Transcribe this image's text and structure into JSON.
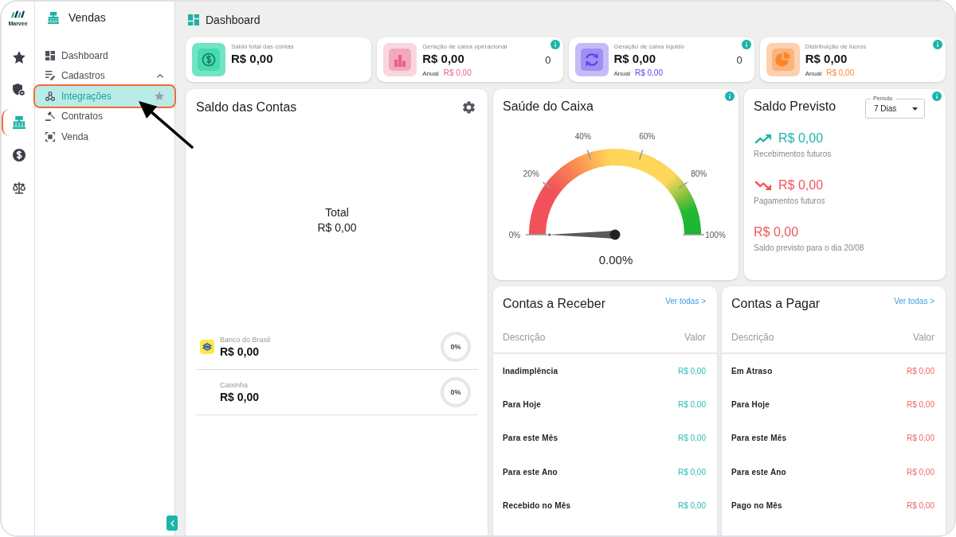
{
  "rail": {
    "logo_text": "Marvee",
    "items": [
      {
        "kind": "star",
        "selected": false
      },
      {
        "kind": "shield",
        "selected": false
      },
      {
        "kind": "register",
        "selected": true
      },
      {
        "kind": "dollar",
        "selected": false
      },
      {
        "kind": "scales",
        "selected": false
      }
    ]
  },
  "sidebar": {
    "title": "Vendas",
    "items": [
      {
        "label": "Dashboard",
        "kind": "dashboard",
        "selected": false
      },
      {
        "label": "Cadastros",
        "kind": "list",
        "expanded": true,
        "children": [
          {
            "label": "Integrações",
            "kind": "integration",
            "selected": true,
            "outlined": true
          },
          {
            "label": "Contratos",
            "kind": "gavel",
            "selected": false,
            "outlined": false
          },
          {
            "label": "Venda",
            "kind": "frame",
            "selected": false,
            "outlined": false
          }
        ]
      }
    ]
  },
  "header": {
    "title": "Dashboard"
  },
  "summary_cards": [
    {
      "kind": "dollar",
      "label": "Saldo total das contas",
      "value": "R$ 0,00",
      "color": "#45dcb0",
      "info": false
    },
    {
      "kind": "bars",
      "label": "Geração de caixa operacional",
      "value": "R$ 0,00",
      "count": "0",
      "annual": {
        "label": "Anual",
        "value": "R$ 0,00"
      },
      "color": "#f2a9bd",
      "info": true
    },
    {
      "kind": "cycle",
      "label": "Geração de caixa líquido",
      "value": "R$ 0,00",
      "count": "0",
      "annual": {
        "label": "Anual",
        "value": "R$ 0,00"
      },
      "color": "#a08ff2",
      "info": true
    },
    {
      "kind": "pie",
      "label": "Distribuição de lucros",
      "value": "R$ 0,00",
      "annual": {
        "label": "Anual",
        "value": "R$ 0,00"
      },
      "color": "#fbb47c",
      "info": true
    }
  ],
  "accounts_panel": {
    "title": "Saldo das Contas",
    "total_label": "Total",
    "total_value": "R$ 0,00",
    "accounts": [
      {
        "name": "Banco do Brasil",
        "value": "R$ 0,00",
        "share": "0%",
        "logo": true
      },
      {
        "name": "Caixinha",
        "value": "R$ 0,00",
        "share": "0%",
        "logo": false
      }
    ]
  },
  "gauge": {
    "title": "Saúde do Caixa",
    "info": true,
    "ticks": [
      "0%",
      "20%",
      "40%",
      "60%",
      "80%",
      "100%"
    ],
    "level": 0,
    "reading": "0.00%"
  },
  "forecast": {
    "title": "Saldo Previsto",
    "info": true,
    "period": {
      "label": "Período",
      "value": "7 Dias"
    },
    "items": [
      {
        "kind": "up",
        "value": "R$ 0,00",
        "caption": "Recebimentos futuros"
      },
      {
        "kind": "down",
        "value": "R$ 0,00",
        "caption": "Pagamentos futuros"
      },
      {
        "kind": "balance",
        "value": "R$ 0,00",
        "caption": "Saldo previsto para o dia 20/08"
      }
    ]
  },
  "lists": [
    {
      "kind": "receivable",
      "title": "Contas a Receber",
      "link": "Ver todas >",
      "columns": [
        "Descrição",
        "Valor"
      ],
      "rows": [
        {
          "label": "Inadimplência",
          "value": "R$ 0,00"
        },
        {
          "label": "Para Hoje",
          "value": "R$ 0,00"
        },
        {
          "label": "Para este Mês",
          "value": "R$ 0,00"
        },
        {
          "label": "Para este Ano",
          "value": "R$ 0,00"
        },
        {
          "label": "Recebido no Mês",
          "value": "R$ 0,00"
        }
      ]
    },
    {
      "kind": "payable",
      "title": "Contas a Pagar",
      "link": "Ver todas >",
      "columns": [
        "Descrição",
        "Valor"
      ],
      "rows": [
        {
          "label": "Em Atraso",
          "value": "R$ 0,00"
        },
        {
          "label": "Para Hoje",
          "value": "R$ 0,00"
        },
        {
          "label": "Para este Mês",
          "value": "R$ 0,00"
        },
        {
          "label": "Para este Ano",
          "value": "R$ 0,00"
        },
        {
          "label": "Pago no Mês",
          "value": "R$ 0,00"
        }
      ]
    }
  ]
}
